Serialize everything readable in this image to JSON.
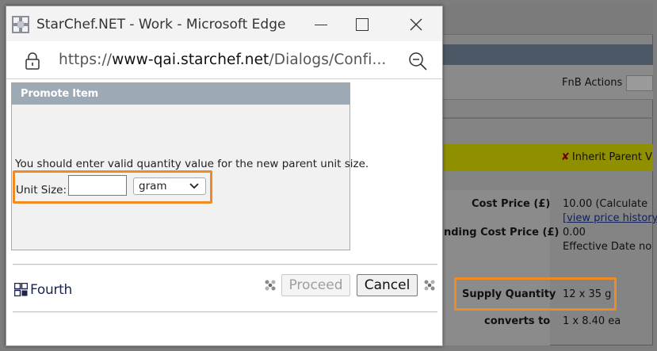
{
  "window": {
    "title": "StarChef.NET - Work - Microsoft Edge",
    "url_prefix": "https://",
    "url_host": "www-qai.starchef.net",
    "url_path": "/Dialogs/Confi..."
  },
  "dialog": {
    "panel_title": "Promote Item",
    "message": "You should enter valid quantity value for the new parent unit size.",
    "unit_size_label": "Unit Size:",
    "unit_size_value": "",
    "unit_selected": "gram",
    "proceed_label": "Proceed",
    "cancel_label": "Cancel",
    "logo_text": "Fourth"
  },
  "background": {
    "fnb_actions_label": "FnB Actions",
    "inherit_label": "Inherit Parent V",
    "cost_price_label": "Cost Price (£)",
    "cost_price_value": "10.00   (Calculate",
    "view_price_history": "[view price history",
    "standing_cost_label": "nding Cost Price (£)",
    "standing_cost_value": "0.00",
    "effective_date_label": "Effective Date  no",
    "supply_quantity_label": "Supply Quantity",
    "supply_quantity_value": "12 x 35 g",
    "converts_to_label": "converts to",
    "converts_to_value": "1 x 8.40 ea"
  },
  "colors": {
    "highlight": "#ef8b22",
    "panel_header": "#9ea9b6",
    "logo": "#1c2350"
  }
}
